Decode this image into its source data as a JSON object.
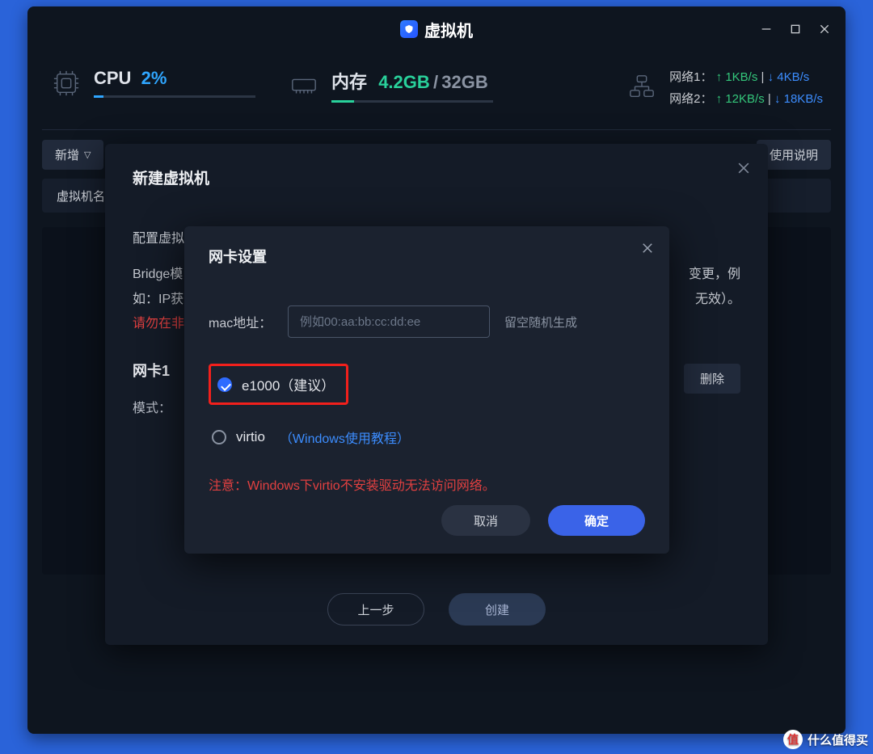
{
  "titlebar": {
    "title": "虚拟机"
  },
  "stats": {
    "cpu": {
      "label": "CPU",
      "percent": "2%"
    },
    "mem": {
      "label": "内存",
      "used": "4.2GB",
      "sep": "/",
      "total": "32GB"
    },
    "net1": {
      "label": "网络1：",
      "up": "1KB/s",
      "down": "4KB/s"
    },
    "net2": {
      "label": "网络2：",
      "up": "12KB/s",
      "down": "18KB/s"
    }
  },
  "toolbar": {
    "add": "新增",
    "help": "使用说明"
  },
  "table": {
    "col_name": "虚拟机名称"
  },
  "modal1": {
    "title": "新建虚拟机",
    "cfg_label": "配置虚拟网络：",
    "line1_a": "Bridge模",
    "line1_b": "变更，例",
    "line2_a": "如：IP获",
    "line2_b": "无效）。",
    "warn": "请勿在非",
    "nic_title": "网卡1",
    "mode_label": "模式：",
    "delete": "删除",
    "prev": "上一步",
    "create": "创建"
  },
  "modal2": {
    "title": "网卡设置",
    "mac_label": "mac地址：",
    "mac_placeholder": "例如00:aa:bb:cc:dd:ee",
    "mac_hint": "留空随机生成",
    "opt_e1000": "e1000（建议）",
    "opt_virtio": "virtio",
    "virtio_link": "（Windows使用教程）",
    "note": "注意：Windows下virtio不安装驱动无法访问网络。",
    "cancel": "取消",
    "ok": "确定"
  },
  "watermark": {
    "badge": "值",
    "text": "什么值得买"
  }
}
